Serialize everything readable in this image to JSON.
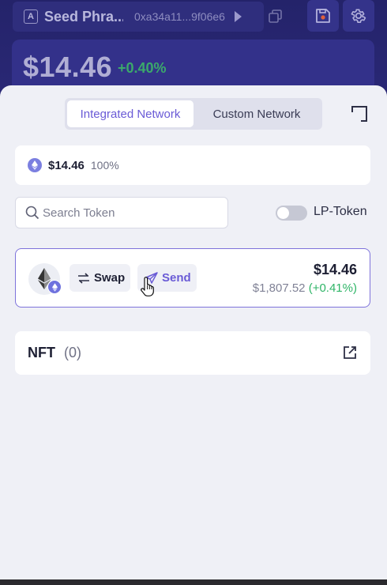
{
  "header": {
    "account_badge": "A",
    "account_name": "Seed Phra...",
    "address": "0xa34a11...9f06e6",
    "balance": "$14.46",
    "balance_change": "+0.40%"
  },
  "tabs": {
    "integrated": "Integrated Network",
    "custom": "Custom Network"
  },
  "summary": {
    "value": "$14.46",
    "percent": "100%"
  },
  "search": {
    "placeholder": "Search Token",
    "value": ""
  },
  "lp_token": {
    "label": "LP-Token",
    "enabled": false
  },
  "token": {
    "value": "$14.46",
    "price": "$1,807.52",
    "change": "(+0.41%)",
    "swap_label": "Swap",
    "send_label": "Send"
  },
  "nft": {
    "label": "NFT",
    "count": "(0)"
  },
  "colors": {
    "accent": "#6a5bd6",
    "positive": "#2fb567",
    "header_bg": "#24236a"
  }
}
